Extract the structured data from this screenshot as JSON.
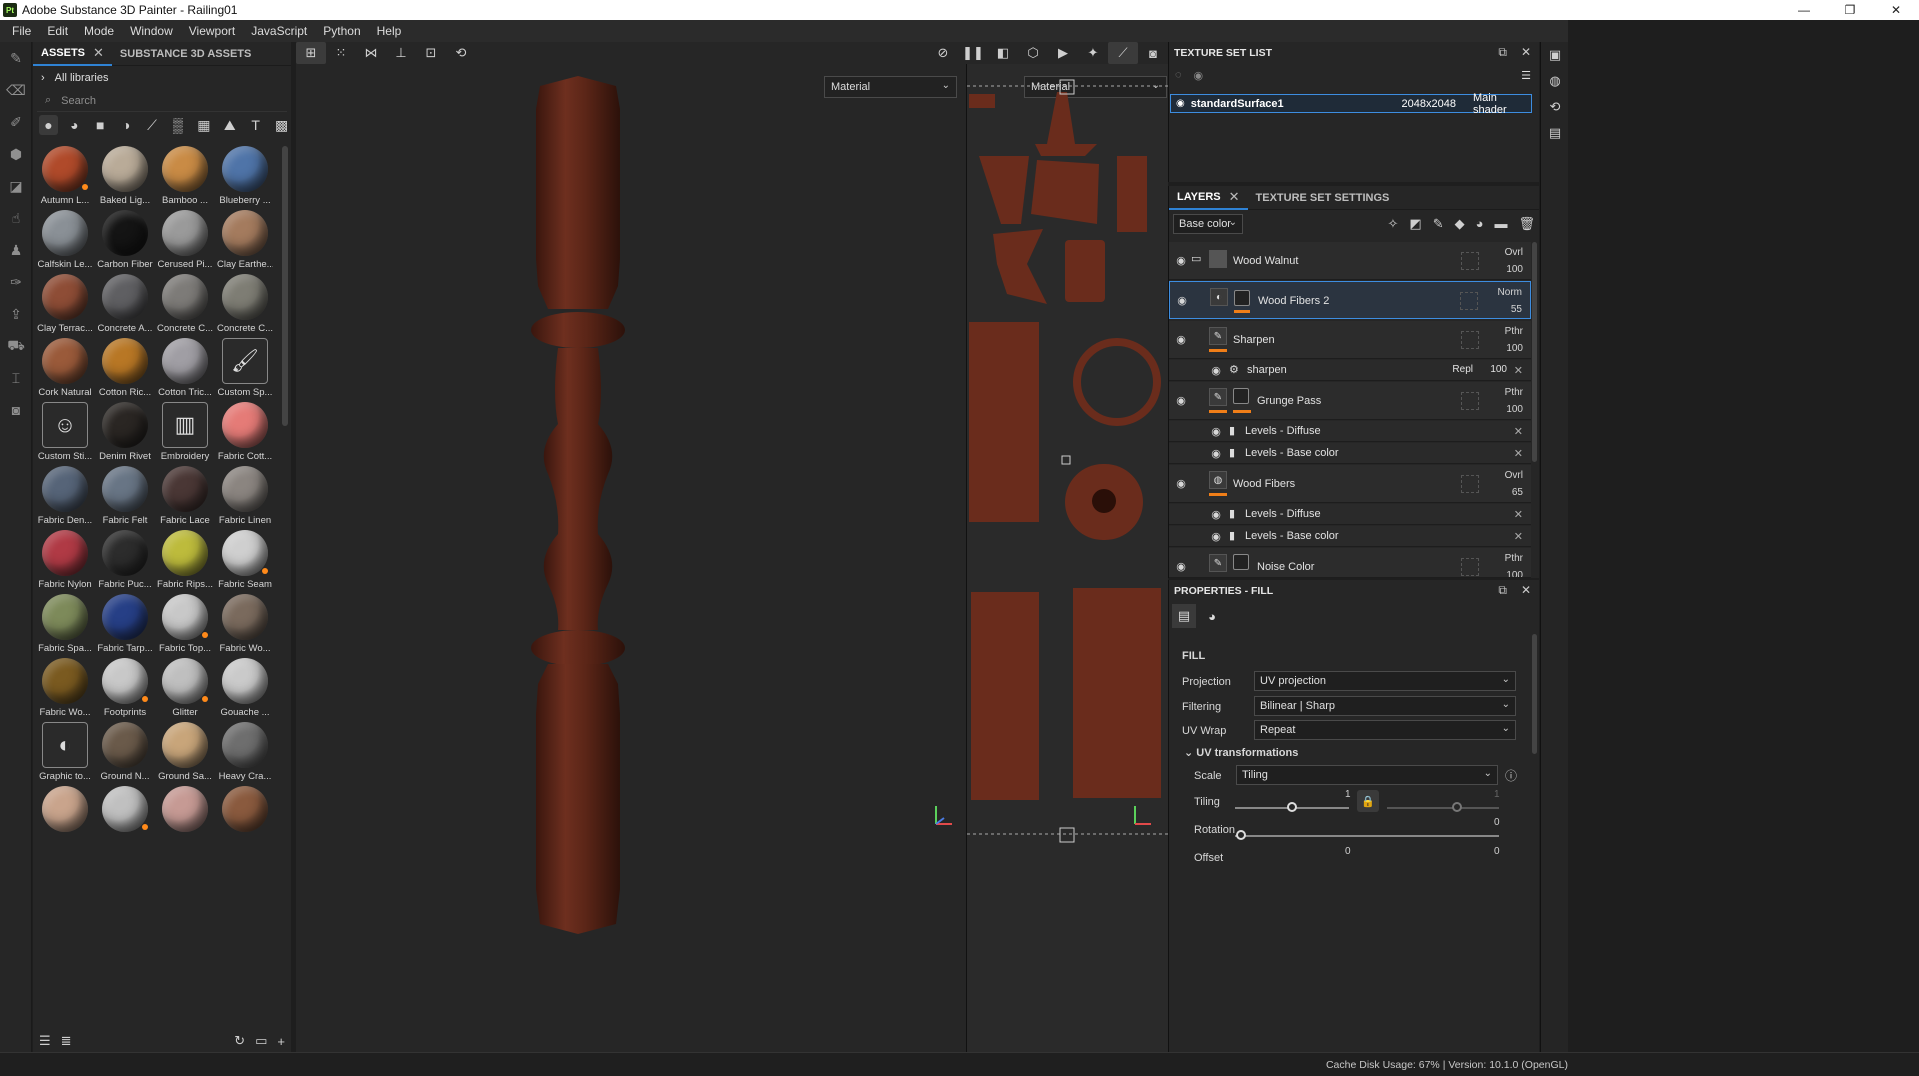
{
  "window": {
    "app_icon": "Pt",
    "title": "Adobe Substance 3D Painter - Railing01",
    "controls": [
      "—",
      "❐",
      "✕"
    ]
  },
  "menu": [
    "File",
    "Edit",
    "Mode",
    "Window",
    "Viewport",
    "JavaScript",
    "Python",
    "Help"
  ],
  "assets_panel": {
    "tabs": [
      "ASSETS",
      "SUBSTANCE 3D ASSETS"
    ],
    "close_glyph": "✕",
    "all_libraries": "All libraries",
    "search_placeholder": "Search",
    "items": [
      {
        "label": "Autumn L...",
        "color": "#b04a2a",
        "badge": true
      },
      {
        "label": "Baked Lig...",
        "color": "#b9ab98",
        "badge": false
      },
      {
        "label": "Bamboo ...",
        "color": "#c98b45",
        "badge": false
      },
      {
        "label": "Blueberry ...",
        "color": "#4f74a8",
        "badge": false
      },
      {
        "label": "Calfskin Le...",
        "color": "#8a9096",
        "badge": false
      },
      {
        "label": "Carbon Fiber",
        "color": "#141414",
        "badge": false
      },
      {
        "label": "Cerused Pi...",
        "color": "#9a9a9a",
        "badge": false
      },
      {
        "label": "Clay Earthe...",
        "color": "#a47b5e",
        "badge": false
      },
      {
        "label": "Clay Terrac...",
        "color": "#8e4d36",
        "badge": false
      },
      {
        "label": "Concrete A...",
        "color": "#5f5f62",
        "badge": false
      },
      {
        "label": "Concrete C...",
        "color": "#7d7b78",
        "badge": false
      },
      {
        "label": "Concrete C...",
        "color": "#7e7d74",
        "badge": false
      },
      {
        "label": "Cork Natural",
        "color": "#9a5a3a",
        "badge": false
      },
      {
        "label": "Cotton Ric...",
        "color": "#b87725",
        "badge": false
      },
      {
        "label": "Cotton Tric...",
        "color": "#a09ea4",
        "badge": false
      },
      {
        "label": "Custom Sp...",
        "icon": "🖌",
        "badge": false
      },
      {
        "label": "Custom Sti...",
        "icon": "☺",
        "badge": false
      },
      {
        "label": "Denim Rivet",
        "color": "#2a2623",
        "badge": false
      },
      {
        "label": "Embroidery",
        "icon": "▥",
        "badge": false
      },
      {
        "label": "Fabric Cott...",
        "color": "#e57b77",
        "badge": false
      },
      {
        "label": "Fabric Den...",
        "color": "#566478",
        "badge": false
      },
      {
        "label": "Fabric Felt",
        "color": "#687585",
        "badge": false
      },
      {
        "label": "Fabric Lace",
        "color": "#4a3735",
        "badge": false
      },
      {
        "label": "Fabric Linen",
        "color": "#8b8580",
        "badge": false
      },
      {
        "label": "Fabric Nylon",
        "color": "#b03a45",
        "badge": false
      },
      {
        "label": "Fabric Puc...",
        "color": "#2c2c2c",
        "badge": false
      },
      {
        "label": "Fabric Rips...",
        "color": "#bdbb3c",
        "badge": false
      },
      {
        "label": "Fabric Seam",
        "color": "#cfcfcf",
        "badge": true
      },
      {
        "label": "Fabric Spa...",
        "color": "#7d8a5a",
        "badge": false
      },
      {
        "label": "Fabric Tarp...",
        "color": "#263f86",
        "badge": false
      },
      {
        "label": "Fabric Top...",
        "color": "#c8c8c8",
        "badge": true
      },
      {
        "label": "Fabric Wo...",
        "color": "#7a6a5d",
        "badge": false
      },
      {
        "label": "Fabric Wo...",
        "color": "#7a5a20",
        "badge": false
      },
      {
        "label": "Footprints",
        "color": "#c8c8c8",
        "badge": true
      },
      {
        "label": "Glitter",
        "color": "#bfbfbf",
        "badge": true
      },
      {
        "label": "Gouache ...",
        "color": "#cacaca",
        "badge": false
      },
      {
        "label": "Graphic to...",
        "icon": "◐",
        "badge": false
      },
      {
        "label": "Ground N...",
        "color": "#6a5a4a",
        "badge": false
      },
      {
        "label": "Ground Sa...",
        "color": "#c8a57a",
        "badge": false
      },
      {
        "label": "Heavy Cra...",
        "color": "#6e6e6e",
        "badge": false
      },
      {
        "label": "",
        "color": "#c9a48c",
        "badge": false
      },
      {
        "label": "",
        "color": "#c0c0c0",
        "badge": true
      },
      {
        "label": "",
        "color": "#c69a94",
        "badge": false
      },
      {
        "label": "",
        "color": "#8a5a3e",
        "badge": false
      }
    ]
  },
  "viewport": {
    "material_dropdown_3d": "Material",
    "material_dropdown_2d": "Material"
  },
  "texture_set_list": {
    "title": "TEXTURE SET LIST",
    "row": {
      "name": "standardSurface1",
      "resolution": "2048x2048",
      "shader": "Main shader"
    }
  },
  "layers": {
    "tabs": [
      "LAYERS",
      "TEXTURE SET SETTINGS"
    ],
    "channel": "Base color",
    "rows": [
      {
        "name": "Wood Walnut",
        "blend": "Ovrl",
        "opacity": "100"
      },
      {
        "name": "Wood Fibers 2",
        "blend": "Norm",
        "opacity": "55"
      },
      {
        "name": "Sharpen",
        "blend": "Pthr",
        "opacity": "100"
      },
      {
        "name": "sharpen",
        "blend": "Repl",
        "opacity": "100"
      },
      {
        "name": "Grunge Pass",
        "blend": "Pthr",
        "opacity": "100"
      },
      {
        "name": "Levels - Diffuse"
      },
      {
        "name": "Levels - Base color"
      },
      {
        "name": "Wood Fibers",
        "blend": "Ovrl",
        "opacity": "65"
      },
      {
        "name": "Levels - Diffuse"
      },
      {
        "name": "Levels - Base color"
      },
      {
        "name": "Noise Color",
        "blend": "Pthr",
        "opacity": "100"
      }
    ]
  },
  "properties": {
    "title": "PROPERTIES - FILL",
    "section": "FILL",
    "projection_label": "Projection",
    "projection_value": "UV projection",
    "filtering_label": "Filtering",
    "filtering_value": "Bilinear | Sharp",
    "uvwrap_label": "UV Wrap",
    "uvwrap_value": "Repeat",
    "uvtrans_label": "UV transformations",
    "scale_label": "Scale",
    "scale_value": "Tiling",
    "tiling_label": "Tiling",
    "tiling_value": "1",
    "tiling_value2": "1",
    "tiling_level": 0.5,
    "rotation_label": "Rotation",
    "rotation_value": "0",
    "offset_label": "Offset",
    "offset_value_a": "0",
    "offset_value_b": "0",
    "tiling_side_value": "0"
  },
  "status": {
    "text": "Cache Disk Usage:   67% | Version: 10.1.0 (OpenGL)"
  },
  "colors": {
    "accent": "#2f82d4",
    "orange": "#f07e18",
    "wood": "#6b2e1e"
  }
}
